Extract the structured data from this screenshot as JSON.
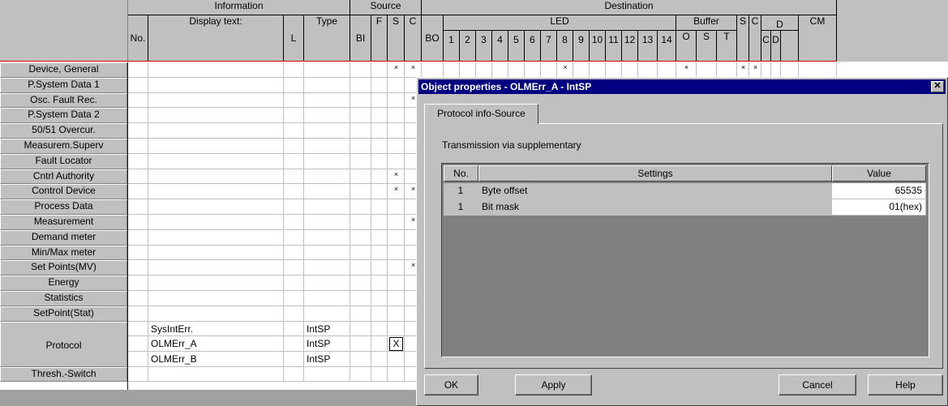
{
  "header": {
    "information": "Information",
    "source": "Source",
    "destination": "Destination",
    "no": "No.",
    "display_text": "Display text:",
    "l": "L",
    "type": "Type",
    "bi": "BI",
    "f": "F",
    "s": "S",
    "c": "C",
    "bo": "BO",
    "led": "LED",
    "led_nums": [
      "1",
      "2",
      "3",
      "4",
      "5",
      "6",
      "7",
      "8",
      "9",
      "10",
      "11",
      "12",
      "13",
      "14"
    ],
    "buffer": "Buffer",
    "buf_o": "O",
    "buf_s": "S",
    "buf_t": "T",
    "dest_s": "S",
    "dest_c": "C",
    "d": "D",
    "d_c": "C",
    "d_d": "D",
    "cm": "CM"
  },
  "rows": [
    {
      "label": "Device, General"
    },
    {
      "label": "P.System Data 1"
    },
    {
      "label": "Osc. Fault Rec."
    },
    {
      "label": "P.System Data 2"
    },
    {
      "label": "50/51 Overcur."
    },
    {
      "label": "Measurem.Superv"
    },
    {
      "label": "Fault Locator"
    },
    {
      "label": "Cntrl Authority"
    },
    {
      "label": "Control Device"
    },
    {
      "label": "Process Data"
    },
    {
      "label": "Measurement"
    },
    {
      "label": "Demand meter"
    },
    {
      "label": "Min/Max meter"
    },
    {
      "label": "Set Points(MV)"
    },
    {
      "label": "Energy"
    },
    {
      "label": "Statistics"
    },
    {
      "label": "SetPoint(Stat)"
    },
    {
      "label": "Protocol"
    },
    {
      "label": "Thresh.-Switch"
    }
  ],
  "marks": {
    "x": "×",
    "X": "X"
  },
  "protocol_items": [
    {
      "text": "SysIntErr.",
      "type": "IntSP"
    },
    {
      "text": "OLMErr_A",
      "type": "IntSP"
    },
    {
      "text": "OLMErr_B",
      "type": "IntSP"
    }
  ],
  "dialog": {
    "title": "Object properties - OLMErr_A - IntSP",
    "close": "✕",
    "tab": "Protocol info-Source",
    "transmission": "Transmission via supplementary",
    "col_no": "No.",
    "col_settings": "Settings",
    "col_value": "Value",
    "rows": [
      {
        "no": "1",
        "setting": "Byte offset",
        "value": "65535"
      },
      {
        "no": "1",
        "setting": "Bit mask",
        "value": "01(hex)"
      }
    ],
    "ok": "OK",
    "apply": "Apply",
    "cancel": "Cancel",
    "help": "Help"
  }
}
